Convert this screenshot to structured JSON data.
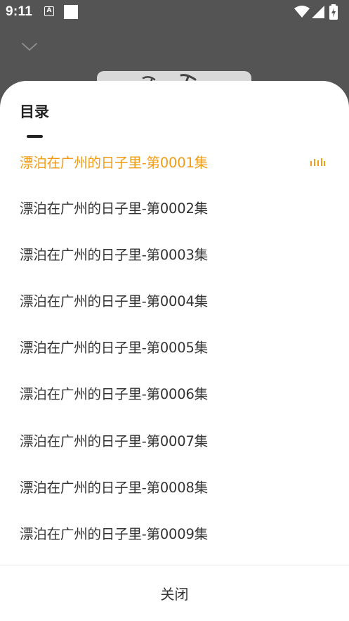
{
  "status_bar": {
    "time": "9:11",
    "a_badge": "A",
    "icons": [
      "notification-a-icon",
      "square-notification-icon",
      "wifi-icon",
      "signal-icon",
      "battery-charging-icon"
    ]
  },
  "header": {
    "collapse_icon": "chevron-down-icon"
  },
  "playlist": {
    "title": "目录",
    "accent_color": "#f09c16",
    "episodes": [
      {
        "title": "漂泊在广州的日子里-第0001集",
        "playing": true
      },
      {
        "title": "漂泊在广州的日子里-第0002集",
        "playing": false
      },
      {
        "title": "漂泊在广州的日子里-第0003集",
        "playing": false
      },
      {
        "title": "漂泊在广州的日子里-第0004集",
        "playing": false
      },
      {
        "title": "漂泊在广州的日子里-第0005集",
        "playing": false
      },
      {
        "title": "漂泊在广州的日子里-第0006集",
        "playing": false
      },
      {
        "title": "漂泊在广州的日子里-第0007集",
        "playing": false
      },
      {
        "title": "漂泊在广州的日子里-第0008集",
        "playing": false
      },
      {
        "title": "漂泊在广州的日子里-第0009集",
        "playing": false
      }
    ],
    "playing_icon": "equalizer-bars-icon",
    "close_label": "关闭"
  }
}
